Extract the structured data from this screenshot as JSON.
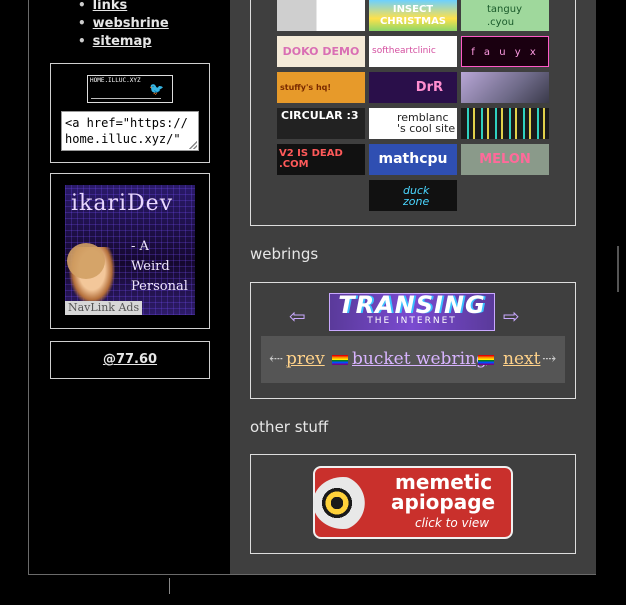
{
  "nav": {
    "items": [
      "links",
      "webshrine",
      "sitemap"
    ]
  },
  "site_button": {
    "label": "HOME.ILLUC.XYZ"
  },
  "embed_code": {
    "value": "<a href=\"https://\nhome.illuc.xyz/\""
  },
  "ad": {
    "name": "ikariDev",
    "line1": "- A",
    "line2": "Weird",
    "line3": "Personal",
    "tag": "NavLink Ads"
  },
  "counter": {
    "label": "@77.60"
  },
  "buttons": [
    {
      "label": ""
    },
    {
      "label": "INSECT CHRISTMAS"
    },
    {
      "label": "tanguy .cyou"
    },
    {
      "label": "DOKO DEMO"
    },
    {
      "label": "softheartclinic"
    },
    {
      "label": "f a u y x"
    },
    {
      "label": "stuffy's hq!"
    },
    {
      "label": "DrR"
    },
    {
      "label": ""
    },
    {
      "label": "CIRCULAR :3"
    },
    {
      "label": "remblanc 's cool site"
    },
    {
      "label": ""
    },
    {
      "label": "V2 IS DEAD .COM"
    },
    {
      "label": "mathcpu"
    },
    {
      "label": "MELON"
    },
    {
      "label": "duck zone"
    }
  ],
  "headings": {
    "webrings": "webrings",
    "other": "other stuff"
  },
  "transing": {
    "big": "TRANSING",
    "small": "THE INTERNET"
  },
  "bucket": {
    "left_arrow": "⇠",
    "prev": "prev",
    "name": "bucket webring",
    "next": "next",
    "right_arrow": "⇢"
  },
  "memetic": {
    "line1": "memetic",
    "line2": "apiopage",
    "line3": "click to view"
  }
}
